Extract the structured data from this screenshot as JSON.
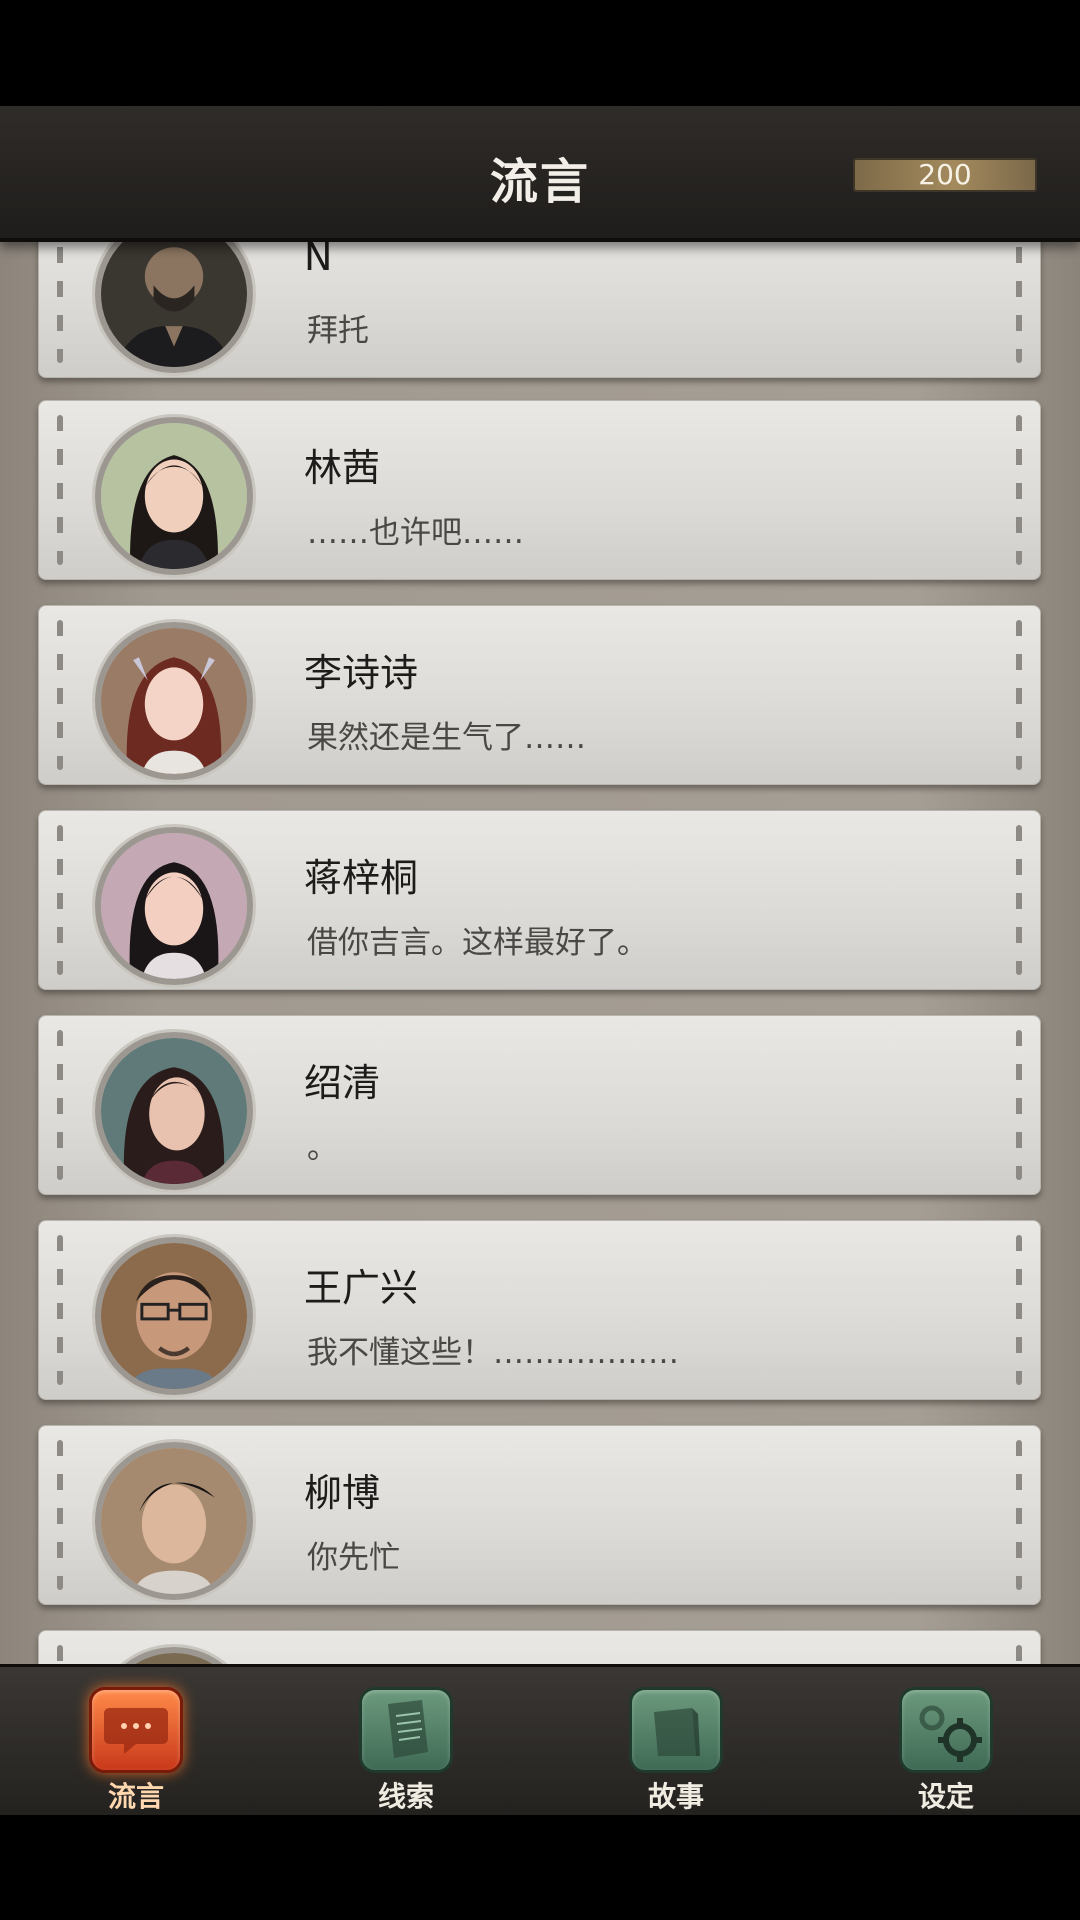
{
  "header": {
    "title": "流言",
    "coins": "200"
  },
  "contacts": [
    {
      "name": "N",
      "message": "拜托",
      "avatar": "man-bearded-avatar"
    },
    {
      "name": "林茜",
      "message": "……也许吧……",
      "avatar": "woman-avatar"
    },
    {
      "name": "李诗诗",
      "message": "果然还是生气了……",
      "avatar": "woman-red-hair-avatar"
    },
    {
      "name": "蒋梓桐",
      "message": "借你吉言。这样最好了。",
      "avatar": "woman-avatar"
    },
    {
      "name": "绍清",
      "message": "。",
      "avatar": "woman-avatar"
    },
    {
      "name": "王广兴",
      "message": "我不懂这些！………………",
      "avatar": "man-glasses-avatar"
    },
    {
      "name": "柳博",
      "message": "你先忙",
      "avatar": "man-avatar"
    }
  ],
  "tabs": [
    {
      "label": "流言",
      "icon": "chat-bubble-icon",
      "active": true
    },
    {
      "label": "线索",
      "icon": "document-icon",
      "active": false
    },
    {
      "label": "故事",
      "icon": "book-icon",
      "active": false
    },
    {
      "label": "设定",
      "icon": "gear-icon",
      "active": false
    }
  ],
  "colors": {
    "active_tab": "#e0521e",
    "inactive_tab": "#4f7d63",
    "header": "#2a2724"
  }
}
